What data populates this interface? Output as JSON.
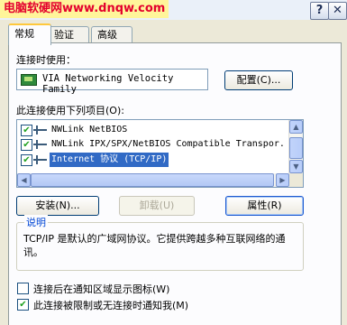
{
  "window": {
    "watermark": "电脑软硬网www.dnqw.com",
    "help_button": "?",
    "close_button": "✕"
  },
  "tabs": [
    {
      "label": "常规",
      "active": true
    },
    {
      "label": "验证",
      "active": false
    },
    {
      "label": "高级",
      "active": false
    }
  ],
  "connect_using": {
    "label": "连接时使用：",
    "adapter": "VIA Networking Velocity Family",
    "configure_button": "配置(C)..."
  },
  "items_section": {
    "label": "此连接使用下列项目(O):",
    "items": [
      {
        "checked": true,
        "label": "NWLink NetBIOS",
        "selected": false
      },
      {
        "checked": true,
        "label": "NWLink IPX/SPX/NetBIOS Compatible Transpor.",
        "selected": false
      },
      {
        "checked": true,
        "label": "Internet 协议 (TCP/IP)",
        "selected": true
      }
    ]
  },
  "actions": {
    "install": "安装(N)...",
    "uninstall": "卸载(U)",
    "properties": "属性(R)"
  },
  "description": {
    "title": "说明",
    "text": "TCP/IP 是默认的广域网协议。它提供跨越多种互联网络的通讯。"
  },
  "options": [
    {
      "checked": false,
      "label": "连接后在通知区域显示图标(W)"
    },
    {
      "checked": true,
      "label": "此连接被限制或无连接时通知我(M)"
    }
  ],
  "colors": {
    "selection": "#316ac5",
    "watermark_text": "#e3002d",
    "dialog_bg": "#ece9d8"
  }
}
